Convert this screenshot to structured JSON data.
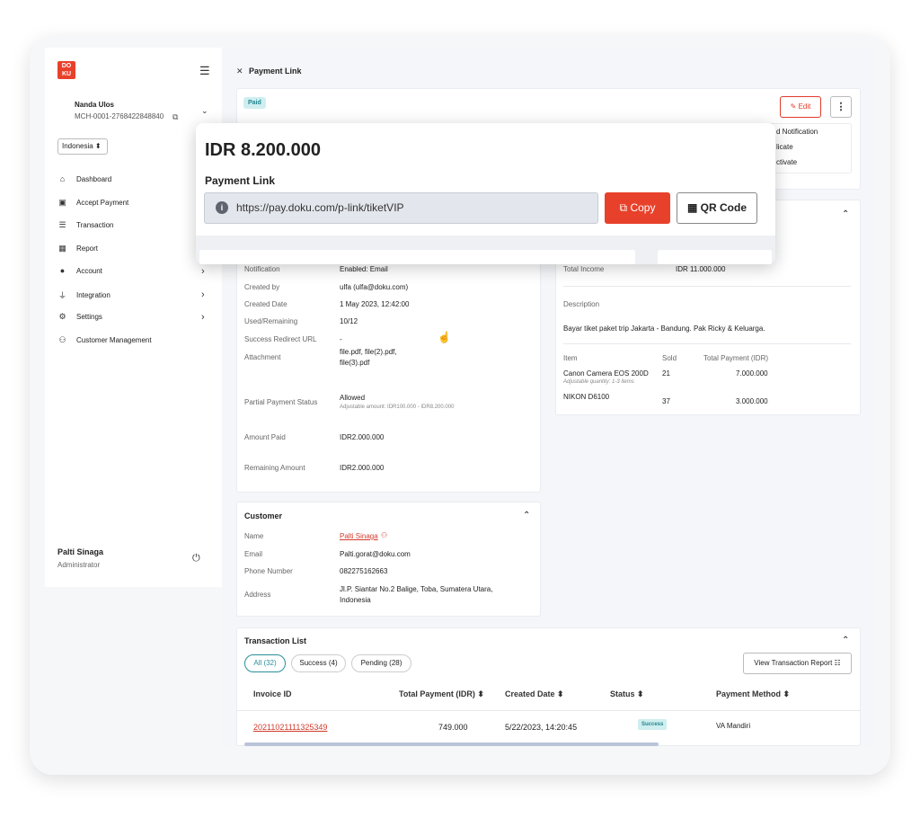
{
  "brand": {
    "logo_text": "DO KU"
  },
  "user": {
    "name": "Nanda Ulos",
    "merchant_id": "MCH-0001-2768422848840",
    "country": "Indonesia ⬍"
  },
  "nav": [
    {
      "label": "Dashboard",
      "icon": "home-icon"
    },
    {
      "label": "Accept Payment",
      "icon": "money-icon"
    },
    {
      "label": "Transaction",
      "icon": "list-icon"
    },
    {
      "label": "Report",
      "icon": "table-icon"
    },
    {
      "label": "Account",
      "icon": "user-icon"
    },
    {
      "label": "Integration",
      "icon": "plug-icon"
    },
    {
      "label": "Settings",
      "icon": "gears-icon"
    },
    {
      "label": "Customer Management",
      "icon": "users-icon"
    }
  ],
  "admin": {
    "name": "Palti Sinaga",
    "role": "Administrator"
  },
  "page": {
    "title": "Payment Link",
    "status": "Paid",
    "edit_label": "Edit"
  },
  "menu_partial": [
    "d Notification",
    "licate",
    "ctivate"
  ],
  "popup": {
    "amount": "IDR 8.200.000",
    "title": "Payment Link",
    "url": "https://pay.doku.com/p-link/tiketVIP",
    "copy_label": "Copy",
    "qr_label": "QR Code"
  },
  "details": {
    "notification_label": "Notification",
    "notification": "Enabled: Email",
    "created_by_label": "Created by",
    "created_by": "ulfa (ulfa@doku.com)",
    "created_date_label": "Created Date",
    "created_date": "1 May 2023, 12:42:00",
    "used_label": "Used/Remaining",
    "used": "10/12",
    "redirect_label": "Success Redirect URL",
    "redirect": "-",
    "attachment_label": "Attachment",
    "attachment_1": "file.pdf, file(2).pdf,",
    "attachment_2": "file(3).pdf",
    "partial_label": "Partial Payment Status",
    "partial": "Allowed",
    "partial_note": "Adjustable amount: IDR100.000 - IDR8.200.000",
    "paid_label": "Amount Paid",
    "paid": "IDR2.000.000",
    "remaining_label": "Remaining Amount",
    "remaining": "IDR2.000.000"
  },
  "summary": {
    "total_income_label": "Total Income",
    "total_income": "IDR 11.000.000",
    "description_label": "Description",
    "description": "Bayar tiket paket trip Jakarta - Bandung. Pak Ricky & Keluarga.",
    "col_item": "Item",
    "col_sold": "Sold",
    "col_total": "Total Payment (IDR)",
    "items": [
      {
        "name": "Canon Camera EOS 200D",
        "note": "Adjustable quantity: 1-3 items",
        "sold": "21",
        "total": "7.000.000"
      },
      {
        "name": "NIKON D6100",
        "note": "",
        "sold": "37",
        "total": "3.000.000"
      }
    ]
  },
  "customer": {
    "title": "Customer",
    "name_label": "Name",
    "name": "Palti Sinaga",
    "email_label": "Email",
    "email": "Palti.gorat@doku.com",
    "phone_label": "Phone Number",
    "phone": "082275162663",
    "address_label": "Address",
    "address_1": "Jl.P. Siantar No.2 Balige, Toba, Sumatera Utara,",
    "address_2": "Indonesia"
  },
  "transactions": {
    "title": "Transaction List",
    "tabs": [
      "All (32)",
      "Success (4)",
      "Pending (28)"
    ],
    "report_label": "View Transaction Report ☷",
    "headers": [
      "Invoice ID",
      "Total Payment (IDR) ⬍",
      "Created Date ⬍",
      "Status ⬍",
      "Payment Method ⬍"
    ],
    "rows": [
      {
        "invoice": "20211021111325349",
        "total": "749.000",
        "date": "5/22/2023, 14:20:45",
        "status": "Success",
        "method": "VA Mandiri"
      }
    ]
  }
}
